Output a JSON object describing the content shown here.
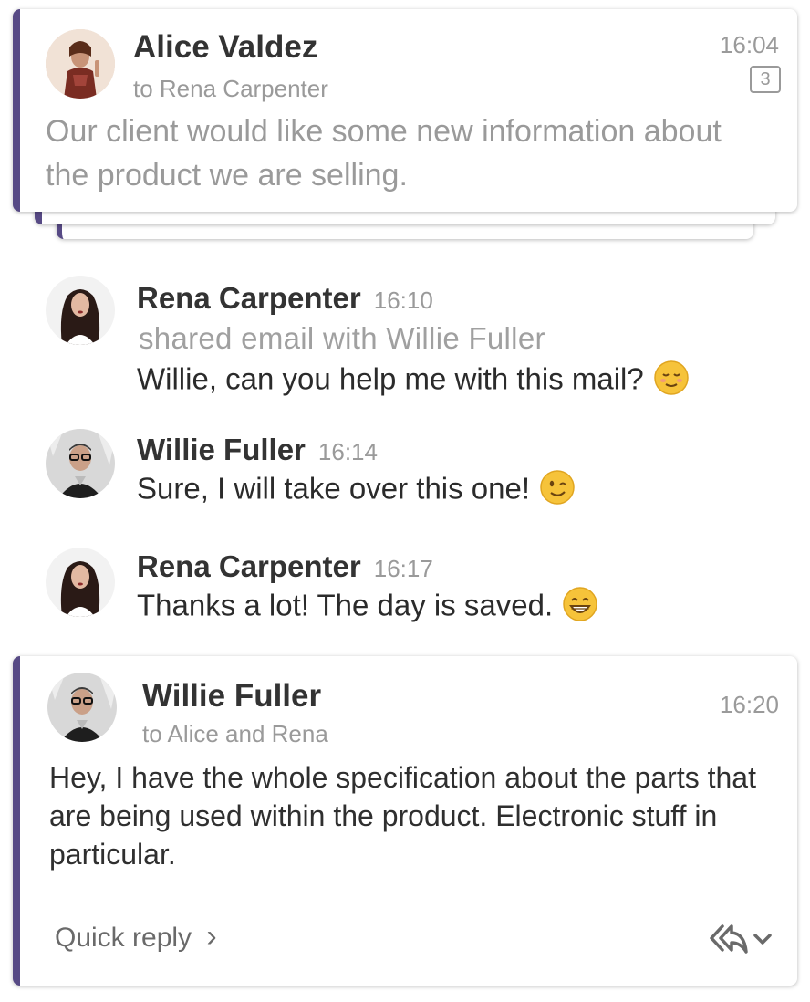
{
  "top_email": {
    "sender": "Alice Valdez",
    "recipient_line": "to Rena Carpenter",
    "time": "16:04",
    "thread_count": "3",
    "preview": "Our client would like some new information about the product we are selling."
  },
  "messages": [
    {
      "sender": "Rena Carpenter",
      "time": "16:10",
      "action": "shared email with Willie Fuller",
      "text": "Willie, can you help me with this mail?",
      "emoji": "relieved-face-emoji"
    },
    {
      "sender": "Willie Fuller",
      "time": "16:14",
      "text": "Sure, I will take over this one!",
      "emoji": "winking-face-emoji"
    },
    {
      "sender": "Rena Carpenter",
      "time": "16:17",
      "text": "Thanks a lot! The day is saved.",
      "emoji": "grinning-face-emoji"
    }
  ],
  "bottom_email": {
    "sender": "Willie Fuller",
    "recipient_line": "to Alice and Rena",
    "time": "16:20",
    "body": "Hey, I have the whole specification about the parts that are being used within the product. Electronic stuff in particular.",
    "quick_reply_label": "Quick reply",
    "quick_reply_chevron": "›"
  },
  "colors": {
    "accent_bar": "#574a85",
    "muted_text": "#9a9a9a",
    "primary_text": "#333333"
  },
  "icons": [
    "reply-all-icon",
    "chevron-down-icon",
    "chevron-right-icon"
  ]
}
